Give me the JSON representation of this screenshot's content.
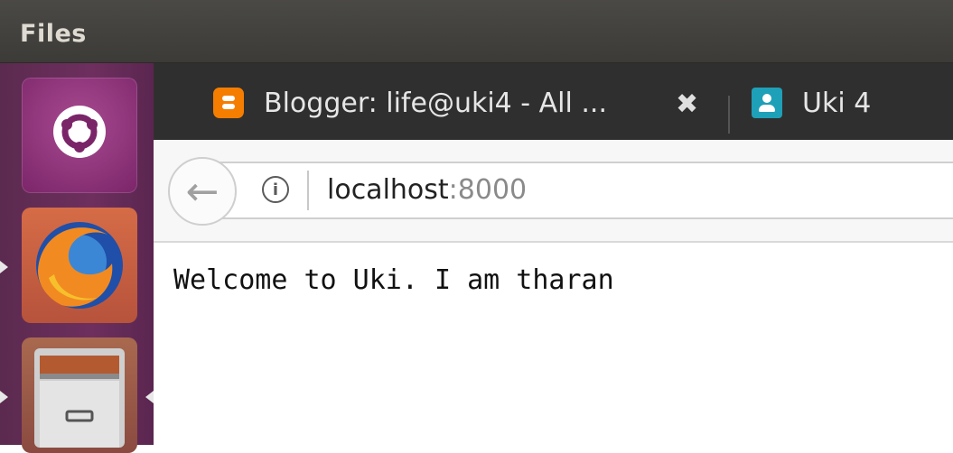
{
  "panel": {
    "title": "Files"
  },
  "launcher": {
    "items": [
      {
        "name": "Ubuntu Dash",
        "icon": "ubuntu-logo-icon"
      },
      {
        "name": "Firefox",
        "icon": "firefox-icon"
      },
      {
        "name": "Files",
        "icon": "file-cabinet-icon"
      }
    ]
  },
  "browser": {
    "tabs": [
      {
        "title": "Blogger: life@uki4 - All ...",
        "icon": "blogger-favicon",
        "close": "✖"
      },
      {
        "title": "Uki 4",
        "icon": "contact-favicon"
      }
    ],
    "url": {
      "host": "localhost",
      "port": ":8000"
    },
    "back_icon": "←",
    "info_icon": "i"
  },
  "page": {
    "body_text": "Welcome to Uki. I am tharan"
  },
  "colors": {
    "launcher": "#6e2f5e",
    "tabbar": "#2f2f2f",
    "panel": "#3c3b37",
    "blogger": "#f57d00",
    "uki_favicon": "#1ea0b8"
  }
}
